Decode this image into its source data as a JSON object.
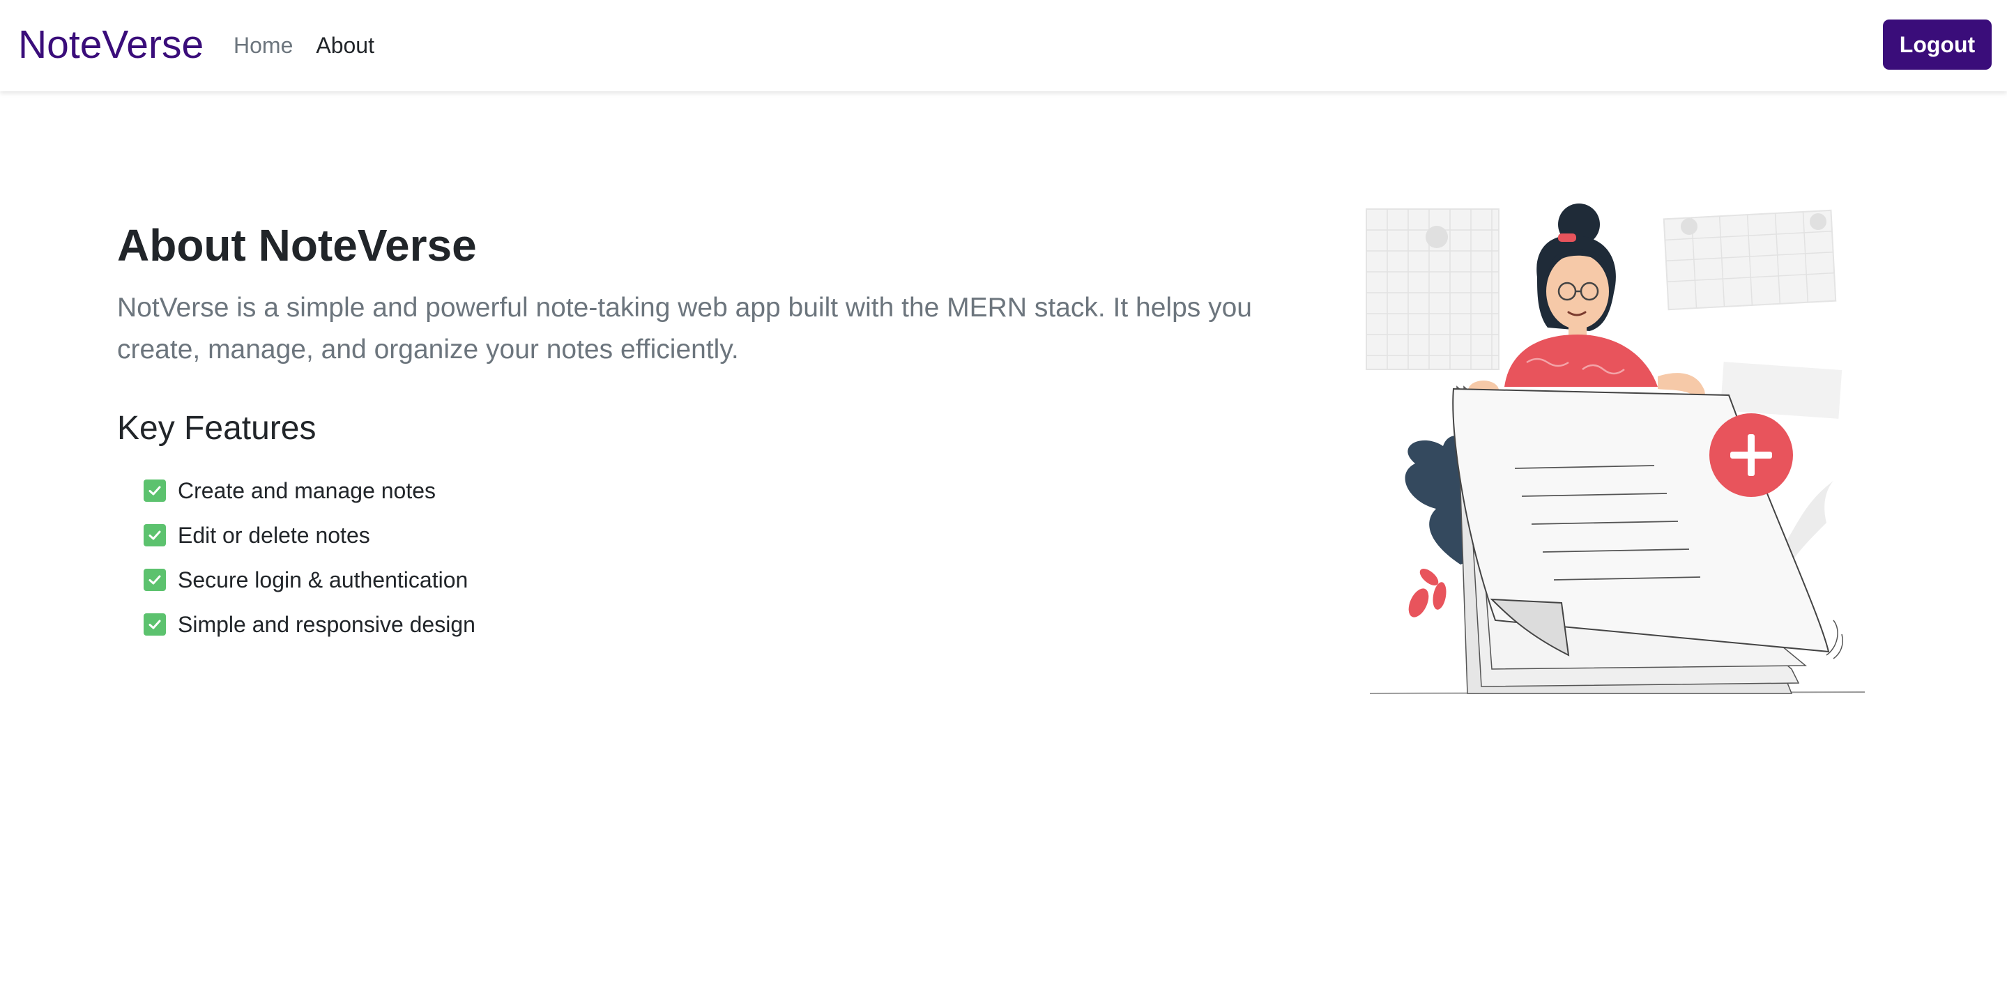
{
  "navbar": {
    "brand": "NoteVerse",
    "links": [
      {
        "label": "Home",
        "active": false
      },
      {
        "label": "About",
        "active": true
      }
    ],
    "logout_label": "Logout"
  },
  "main": {
    "title": "About NoteVerse",
    "description": "NotVerse is a simple and powerful note-taking web app built with the MERN stack. It helps you create, manage, and organize your notes efficiently.",
    "features_heading": "Key Features",
    "features": [
      "Create and manage notes",
      "Edit or delete notes",
      "Secure login & authentication",
      "Simple and responsive design"
    ]
  },
  "illustration": {
    "icon": "woman-holding-note-plus-illustration"
  },
  "colors": {
    "brand": "#3a0d7a",
    "check": "#5cc26e",
    "accent_red": "#e8545c"
  }
}
